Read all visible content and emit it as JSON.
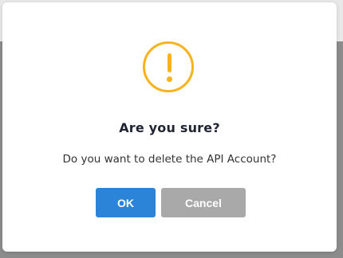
{
  "dialog": {
    "title": "Are you sure?",
    "message": "Do you want to delete the API Account?",
    "icon": "warning-icon",
    "ok_label": "OK",
    "cancel_label": "Cancel"
  },
  "colors": {
    "warning": "#f7b21e",
    "ok_button": "#2b84d8",
    "cancel_button": "#a9a9a9"
  }
}
